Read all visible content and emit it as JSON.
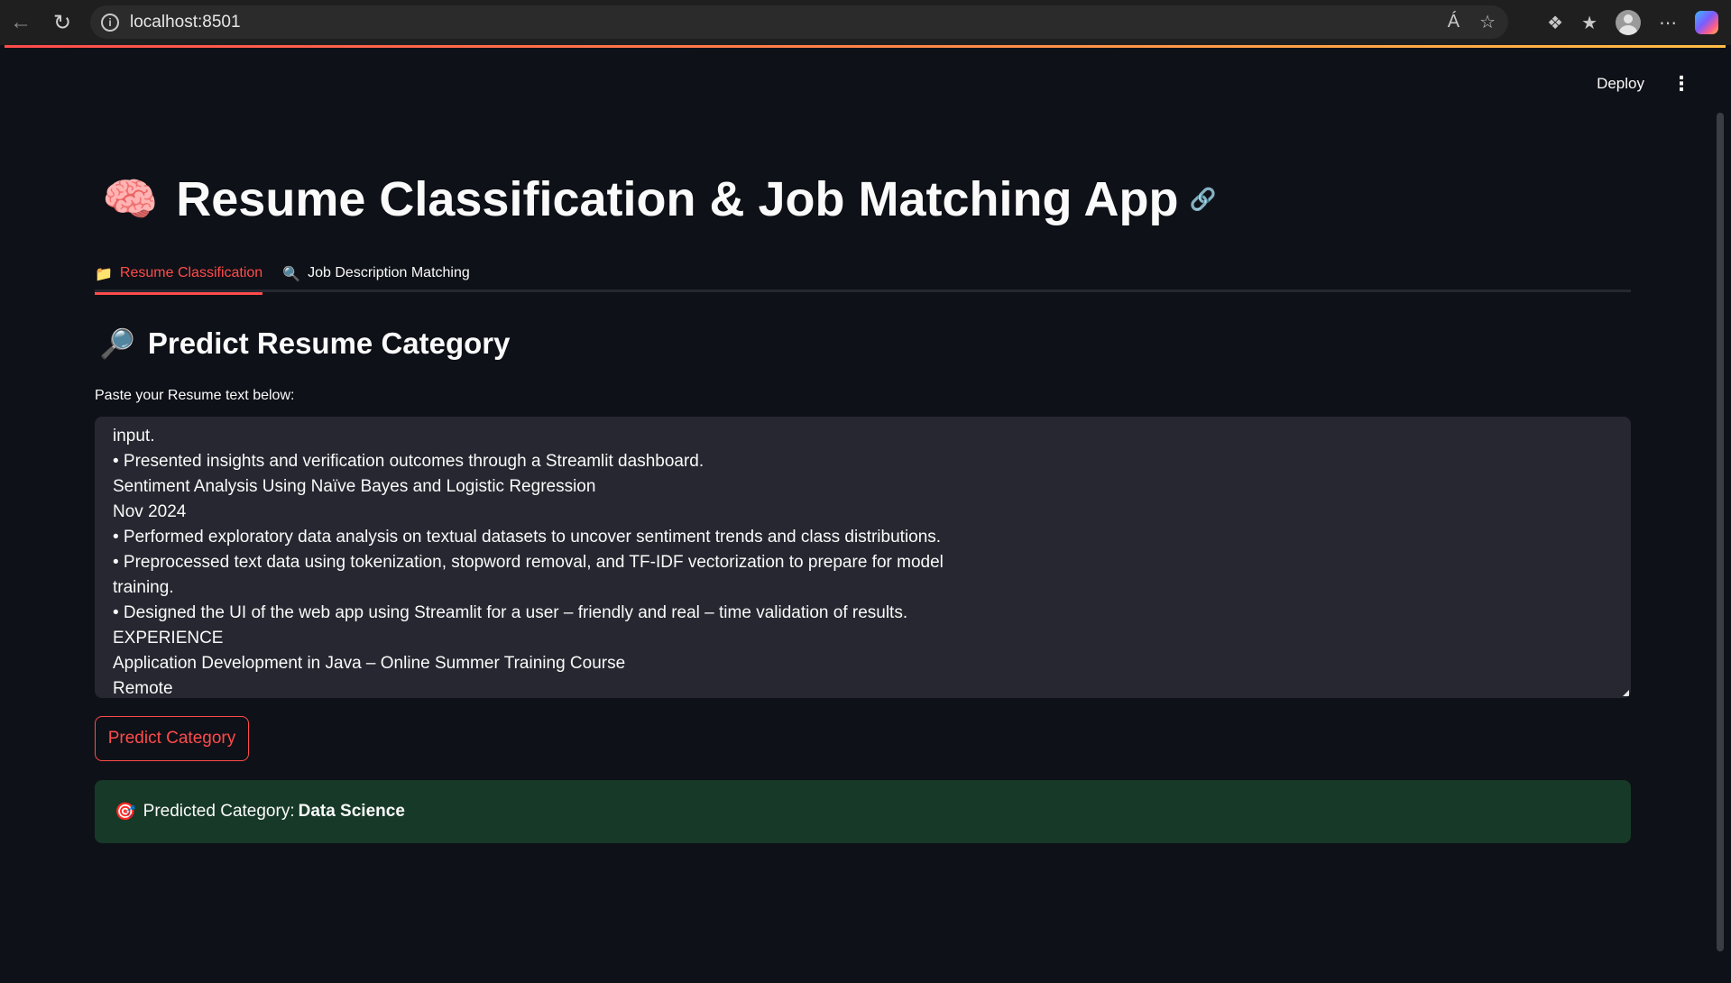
{
  "browser": {
    "url": "localhost:8501",
    "back_icon": "back-arrow-icon",
    "reload_icon": "reload-icon"
  },
  "header": {
    "deploy_label": "Deploy",
    "menu_icon": "kebab-menu-icon"
  },
  "app": {
    "title_emoji": "🧠",
    "title": "Resume Classification & Job Matching App"
  },
  "tabs": [
    {
      "icon": "📁",
      "label": "Resume Classification",
      "active": true
    },
    {
      "icon": "🔍",
      "label": "Job Description Matching",
      "active": false
    }
  ],
  "classification": {
    "sub_emoji": "🔎",
    "subheader": "Predict Resume Category",
    "textarea_label": "Paste your Resume text below:",
    "textarea_lines": [
      "input.",
      "• Presented insights and verification outcomes through a Streamlit dashboard.",
      "Sentiment Analysis Using Naïve Bayes and Logistic Regression",
      "Nov 2024",
      "• Performed exploratory data analysis on textual datasets to uncover sentiment trends and class distributions.",
      "• Preprocessed text data using tokenization, stopword removal, and TF-IDF vectorization to prepare for model",
      "training.",
      "• Designed the UI of the web app using Streamlit for a user – friendly and real – time validation of results.",
      "EXPERIENCE",
      "Application Development in Java – Online Summer Training Course",
      "Remote"
    ],
    "button_label": "Predict Category",
    "result_icon": "🎯",
    "result_prefix": "Predicted Category:",
    "result_value": "Data Science"
  },
  "colors": {
    "background": "#0e1117",
    "accent": "#ff4b4b",
    "success_bg": "#173928",
    "input_bg": "#262730"
  }
}
